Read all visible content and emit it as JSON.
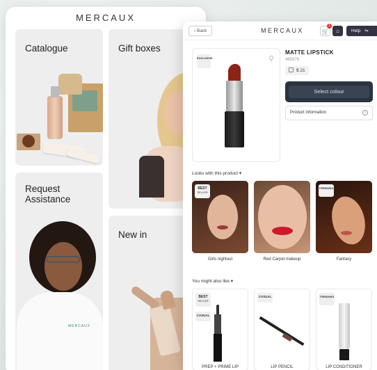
{
  "left_app": {
    "brand": "MERCAUX",
    "tiles": {
      "catalogue": "Catalogue",
      "gift_boxes": "Gift boxes",
      "request_assistance": "Request Assistance",
      "new_in": "New in"
    },
    "shirt_logo": "MERCAUX"
  },
  "right_app": {
    "header": {
      "back_label": "Back",
      "brand": "MERCAUX",
      "cart_count": "1",
      "help_label": "Help"
    },
    "product": {
      "badge": "EXCLUSIVE",
      "title": "MATTE LIPSTICK",
      "sku": "465976",
      "price": "$ 21",
      "select_colour_label": "Select colour",
      "product_info_label": "Product information"
    },
    "looks_heading": "Looks with this product ▾",
    "looks": [
      {
        "badge_top": "BEST",
        "badge_bottom": "SELLER",
        "caption": "Girls nightout"
      },
      {
        "badge_top": "",
        "badge_bottom": "",
        "caption": "Red Carpet makeup"
      },
      {
        "badge_top": "TRENDING",
        "badge_bottom": "",
        "caption": "Fantasy"
      }
    ],
    "also_heading": "You might also like ▾",
    "also_like": [
      {
        "badge_top": "BEST",
        "badge_bottom": "SELLER",
        "badge_extra": "CASUAL",
        "caption": "PREP + PRIME LIP"
      },
      {
        "badge_top": "CASUAL",
        "badge_bottom": "",
        "badge_extra": "",
        "caption": "LIP PENCIL"
      },
      {
        "badge_top": "TRENDING",
        "badge_bottom": "",
        "badge_extra": "",
        "caption": "LIP CONDITIONER"
      }
    ]
  },
  "icons": {
    "back": "chevron-left-icon",
    "cart": "cart-icon",
    "home": "home-icon",
    "help": "toggle-icon",
    "zoom": "search-icon",
    "info": "info-icon",
    "price": "tag-icon"
  },
  "colors": {
    "dark_button": "#2b3340",
    "nav_button": "#334455",
    "lipstick_red": "#8c2417",
    "background": "#e7ecea"
  }
}
